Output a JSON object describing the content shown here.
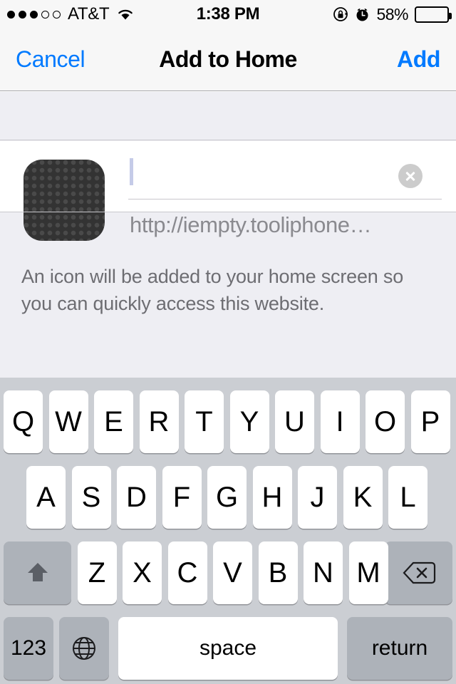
{
  "status_bar": {
    "signal_dots_filled": 3,
    "signal_dots_total": 5,
    "carrier": "AT&T",
    "wifi_icon": "wifi-icon",
    "time": "1:38 PM",
    "rotation_lock_icon": "rotation-lock-icon",
    "alarm_icon": "alarm-clock-icon",
    "battery_percent": "58%",
    "battery_level": 58
  },
  "nav_bar": {
    "cancel_label": "Cancel",
    "title": "Add to Home",
    "add_label": "Add",
    "tint_color": "#007aff"
  },
  "form": {
    "app_icon": "website-thumbnail-icon",
    "name_value": "",
    "name_placeholder": "",
    "clear_icon": "clear-circle-icon",
    "url": "http://iempty.tooliphone…"
  },
  "footnote": {
    "text": "An icon will be added to your home screen so you can quickly access this website."
  },
  "keyboard": {
    "row1": [
      "Q",
      "W",
      "E",
      "R",
      "T",
      "Y",
      "U",
      "I",
      "O",
      "P"
    ],
    "row2": [
      "A",
      "S",
      "D",
      "F",
      "G",
      "H",
      "J",
      "K",
      "L"
    ],
    "row3": [
      "Z",
      "X",
      "C",
      "V",
      "B",
      "N",
      "M"
    ],
    "shift_icon": "shift-up-arrow-icon",
    "backspace_icon": "backspace-delete-icon",
    "numbers_label": "123",
    "globe_icon": "globe-language-icon",
    "space_label": "space",
    "return_label": "return"
  }
}
